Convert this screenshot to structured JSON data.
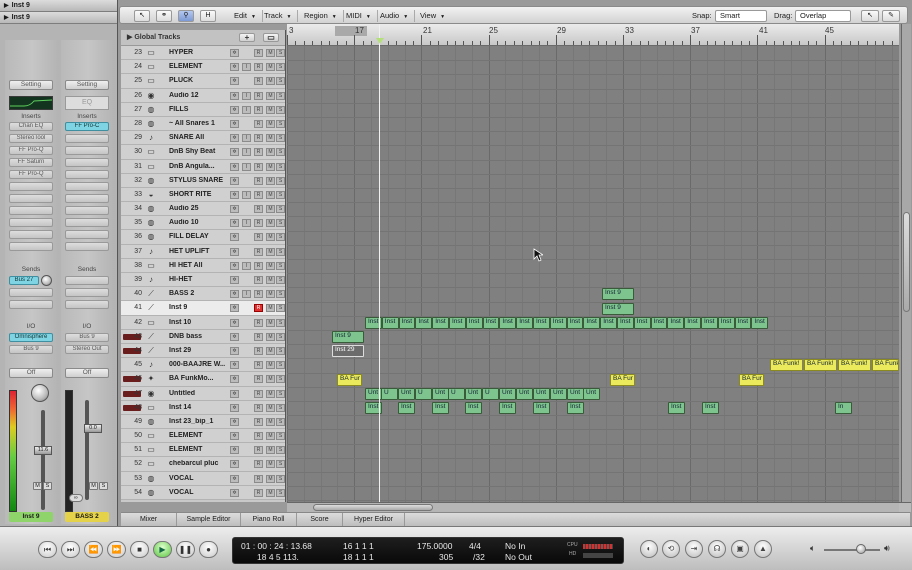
{
  "inspector": {
    "region_header": "Inst 9",
    "track_header": "Inst 9",
    "strip1": {
      "setting": "Setting",
      "inserts_label": "Inserts",
      "inserts": [
        "Chan EQ",
        "StereoTool",
        "FF Pro-Q",
        "FF Saturn",
        "FF Pro-Q"
      ],
      "sends_label": "Sends",
      "send": "Bus 27",
      "io_label": "I/O",
      "input": "Omnisphere",
      "output": "Bus 9",
      "automation": "Off",
      "fader_value": "11.6",
      "mute": "M",
      "solo": "S",
      "name": "Inst 9"
    },
    "strip2": {
      "setting": "Setting",
      "eq": "EQ",
      "inserts_label": "Inserts",
      "inserts": [
        "FF Pro-C"
      ],
      "sends_label": "Sends",
      "io_label": "I/O",
      "input": "Bus 9",
      "output": "Stereo Out",
      "automation": "Off",
      "fader_value": "0.0",
      "mute": "M",
      "solo": "S",
      "name": "BASS 2"
    }
  },
  "toolbar": {
    "menus": [
      "Edit",
      "Track",
      "Region",
      "MIDI",
      "Audio",
      "View"
    ],
    "snap_label": "Snap:",
    "snap_value": "Smart",
    "drag_label": "Drag:",
    "drag_value": "Overlap",
    "h_button": "H"
  },
  "global_tracks": "Global Tracks",
  "tracks": [
    {
      "num": "23",
      "name": "HYPER",
      "icon": "keyboard-icon"
    },
    {
      "num": "24",
      "name": "ELEMENT",
      "icon": "keyboard-icon"
    },
    {
      "num": "25",
      "name": "PLUCK",
      "icon": "keyboard-icon"
    },
    {
      "num": "26",
      "name": "Audio 12",
      "icon": "audio-icon"
    },
    {
      "num": "27",
      "name": "FILLS",
      "icon": "drum-icon"
    },
    {
      "num": "28",
      "name": "~ All Snares 1",
      "icon": "drum-icon"
    },
    {
      "num": "29",
      "name": "SNARE All",
      "icon": "note-icon"
    },
    {
      "num": "30",
      "name": "DnB Shy Beat",
      "icon": "keyboard-icon"
    },
    {
      "num": "31",
      "name": "DnB Angula...",
      "icon": "keyboard-icon"
    },
    {
      "num": "32",
      "name": "STYLUS SNARE",
      "icon": "drum-icon"
    },
    {
      "num": "33",
      "name": "SHORT RITE",
      "icon": "cymbal-icon"
    },
    {
      "num": "34",
      "name": "Audio 25",
      "icon": "drum-icon"
    },
    {
      "num": "35",
      "name": "Audio 10",
      "icon": "drum-icon"
    },
    {
      "num": "36",
      "name": "FILL DELAY",
      "icon": "drum-icon"
    },
    {
      "num": "37",
      "name": "HET UPLIFT",
      "icon": "note-icon"
    },
    {
      "num": "38",
      "name": "HI HET All",
      "icon": "keyboard-icon"
    },
    {
      "num": "39",
      "name": "HI-HET",
      "icon": "note-icon"
    },
    {
      "num": "40",
      "name": "BASS 2",
      "icon": "guitar-icon"
    },
    {
      "num": "41",
      "name": "Inst 9",
      "icon": "guitar-icon"
    },
    {
      "num": "42",
      "name": "Inst 10",
      "icon": "keyboard-icon"
    },
    {
      "num": "43",
      "name": "DNB bass",
      "icon": "guitar-icon"
    },
    {
      "num": "44",
      "name": "Inst 29",
      "icon": "guitar-icon"
    },
    {
      "num": "45",
      "name": "000-BAAJRE W...",
      "icon": "note-icon"
    },
    {
      "num": "46",
      "name": "BA FunkMo...",
      "icon": "sparkle-icon"
    },
    {
      "num": "47",
      "name": "Untitled",
      "icon": "audio-icon"
    },
    {
      "num": "48",
      "name": "Inst 14",
      "icon": "keyboard-icon"
    },
    {
      "num": "49",
      "name": "Inst 23_bip_1",
      "icon": "drum-icon"
    },
    {
      "num": "50",
      "name": "ELEMENT",
      "icon": "keyboard-icon"
    },
    {
      "num": "51",
      "name": "ELEMENT",
      "icon": "keyboard-icon"
    },
    {
      "num": "52",
      "name": "chebarcul pluc",
      "icon": "keyboard-icon"
    },
    {
      "num": "53",
      "name": "VOCAL",
      "icon": "drum-icon"
    },
    {
      "num": "54",
      "name": "VOCAL",
      "icon": "drum-icon"
    }
  ],
  "ruler_bars": [
    "3",
    "17",
    "21",
    "25",
    "29",
    "33",
    "37",
    "41",
    "45"
  ],
  "region_labels": {
    "inst9": "Inst 9",
    "inst": "Inst",
    "inst29": "Inst 29",
    "ba_fun": "BA Fur",
    "ba_funk": "BA Funk!",
    "untitled": "Unt",
    "ui": "U",
    "in": "In"
  },
  "tabs": [
    "Mixer",
    "Sample Editor",
    "Piano Roll",
    "Score",
    "Hyper Editor"
  ],
  "transport": {
    "smpte": "01 : 00 : 24 : 13.68",
    "smpte_sub": "18   4   5  113.",
    "bars": "16   1   1     1",
    "bars_sub": "18   1   1     1",
    "tempo": "175.0000",
    "tempo_sub": "305",
    "sig": "4/4",
    "division": "/32",
    "midi_in": "No In",
    "midi_out": "No Out",
    "cpu_label": "CPU",
    "hd_label": "HD"
  }
}
